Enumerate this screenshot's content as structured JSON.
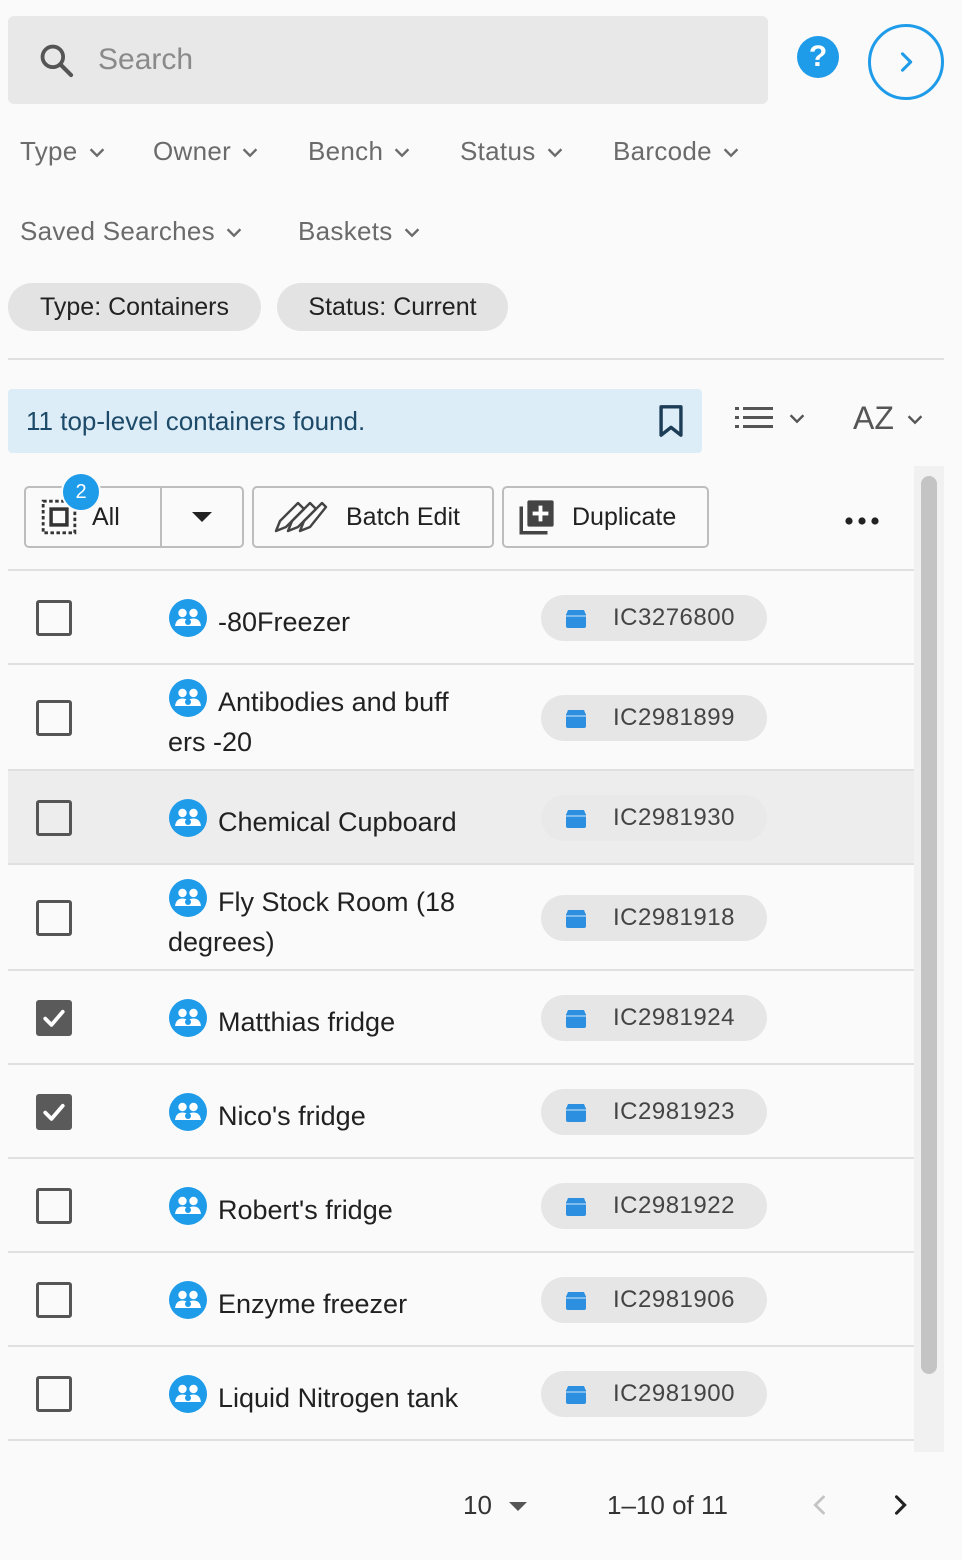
{
  "search": {
    "placeholder": "Search"
  },
  "header": {
    "help_label": "?"
  },
  "filters": [
    {
      "label": "Type"
    },
    {
      "label": "Owner"
    },
    {
      "label": "Bench"
    },
    {
      "label": "Status"
    },
    {
      "label": "Barcode"
    },
    {
      "label": "Saved Searches"
    },
    {
      "label": "Baskets"
    }
  ],
  "active_filters": [
    {
      "label": "Type: Containers"
    },
    {
      "label": "Status: Current"
    }
  ],
  "results": {
    "message": "11 top-level containers found.",
    "sort_label": "AZ"
  },
  "toolbar": {
    "selected_count": "2",
    "select_label": "All",
    "batch_edit_label": "Batch Edit",
    "duplicate_label": "Duplicate"
  },
  "rows": [
    {
      "name_line1": "-80Freezer",
      "name_line2": "",
      "code": "IC3276800",
      "checked": false
    },
    {
      "name_line1": "Antibodies and buff",
      "name_line2": "ers -20",
      "code": "IC2981899",
      "checked": false
    },
    {
      "name_line1": "Chemical Cupboard",
      "name_line2": "",
      "code": "IC2981930",
      "checked": false
    },
    {
      "name_line1": "Fly Stock Room (18",
      "name_line2": "degrees)",
      "code": "IC2981918",
      "checked": false
    },
    {
      "name_line1": "Matthias fridge",
      "name_line2": "",
      "code": "IC2981924",
      "checked": true
    },
    {
      "name_line1": "Nico's fridge",
      "name_line2": "",
      "code": "IC2981923",
      "checked": true
    },
    {
      "name_line1": "Robert's fridge",
      "name_line2": "",
      "code": "IC2981922",
      "checked": false
    },
    {
      "name_line1": "Enzyme freezer",
      "name_line2": "",
      "code": "IC2981906",
      "checked": false
    },
    {
      "name_line1": "Liquid Nitrogen tank",
      "name_line2": "",
      "code": "IC2981900",
      "checked": false
    }
  ],
  "pagination": {
    "page_size": "10",
    "range": "1–10 of 11"
  },
  "colors": {
    "accent": "#1e9be9",
    "info_bg": "#dcedf8",
    "checkbox_checked": "#5a5a5a"
  }
}
